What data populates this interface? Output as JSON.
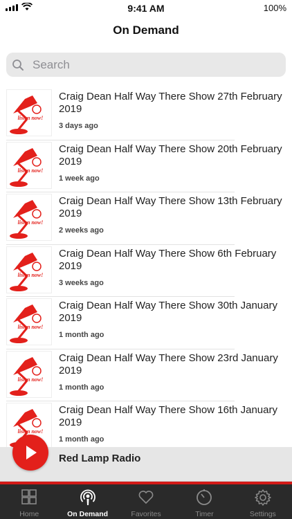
{
  "status": {
    "time": "9:41 AM",
    "battery": "100%"
  },
  "header": {
    "title": "On Demand"
  },
  "search": {
    "placeholder": "Search"
  },
  "episodes": [
    {
      "title": "Craig Dean Half Way There Show 27th February 2019",
      "age": "3 days ago"
    },
    {
      "title": "Craig Dean Half Way There Show 20th February 2019",
      "age": "1 week ago"
    },
    {
      "title": "Craig Dean Half Way There Show 13th February 2019",
      "age": "2 weeks ago"
    },
    {
      "title": "Craig Dean Half Way There Show 6th February 2019",
      "age": "3 weeks ago"
    },
    {
      "title": "Craig Dean Half Way There Show 30th January 2019",
      "age": "1 month ago"
    },
    {
      "title": "Craig Dean Half Way There Show 23rd January 2019",
      "age": "1 month ago"
    },
    {
      "title": "Craig Dean Half Way There Show 16th January 2019",
      "age": "1 month ago"
    }
  ],
  "thumbnail": {
    "text": "listen now!",
    "icon": "red-lamp-icon"
  },
  "player": {
    "station": "Red Lamp Radio",
    "icon": "play-icon"
  },
  "tabs": [
    {
      "label": "Home",
      "icon": "grid-icon",
      "active": false
    },
    {
      "label": "On Demand",
      "icon": "podcast-icon",
      "active": true
    },
    {
      "label": "Favorites",
      "icon": "heart-icon",
      "active": false
    },
    {
      "label": "Timer",
      "icon": "timer-icon",
      "active": false
    },
    {
      "label": "Settings",
      "icon": "gear-icon",
      "active": false
    }
  ],
  "colors": {
    "accent": "#e3201b",
    "tabbar": "#2a2a2a",
    "search_bg": "#e8e8e8"
  }
}
